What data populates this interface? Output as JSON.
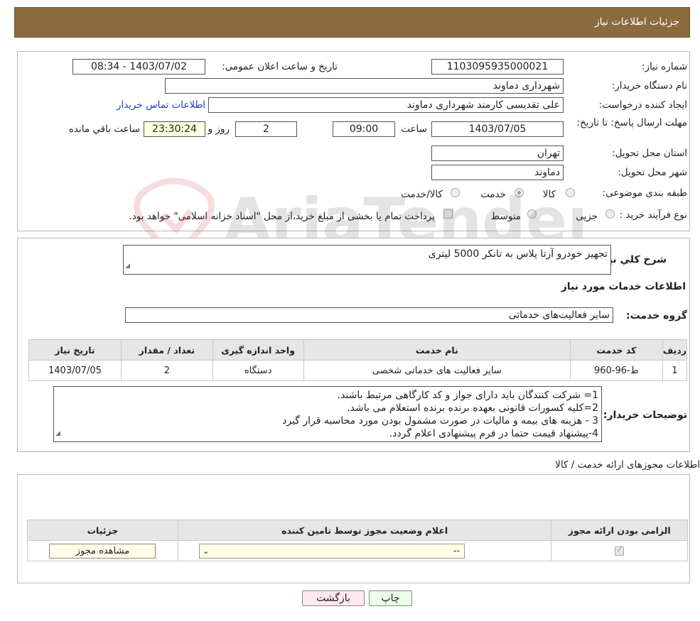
{
  "header": {
    "title": "جزئیات اطلاعات نیاز"
  },
  "form": {
    "need_number_label": "شماره نیاز:",
    "need_number": "1103095935000021",
    "announce_label": "تاریخ و ساعت اعلان عمومی:",
    "announce_value": "1403/07/02 - 08:34",
    "buyer_label": "نام دستگاه خریدار:",
    "buyer_value": "شهرداری دماوند",
    "creator_label": "ایجاد کننده درخواست:",
    "creator_value": "علی تقدیسی کارمند شهرداری دماوند",
    "contact_link": "اطلاعات تماس خریدار",
    "deadline_label": "مهلت ارسال پاسخ: تا تاریخ:",
    "deadline_date": "1403/07/05",
    "time_label": "ساعت",
    "deadline_time": "09:00",
    "days_value": "2",
    "days_label": "روز و",
    "remaining_value": "23:30:24",
    "remaining_label": "ساعت باقي مانده",
    "province_label": "استان محل تحویل:",
    "province_value": "تهران",
    "city_label": "شهر محل تحویل:",
    "city_value": "دماوند",
    "category_label": "طبقه بندی موضوعی:",
    "category_options": [
      "کالا",
      "خدمت",
      "کالا/خدمت"
    ],
    "category_selected": "خدمت",
    "process_label": "نوع فرآیند خرید :",
    "process_options": [
      "جزیی",
      "متوسط"
    ],
    "payment_note": "پرداخت تمام یا بخشی از مبلغ خرید،از محل \"اسناد خزانه اسلامی\" خواهد بود."
  },
  "watermark": {
    "text": "AriaTender.neT"
  },
  "summary": {
    "desc_label": "شرح كلي نياز:",
    "desc_value": "تجهیز خودرو آرتا پلاس به تانکر 5000 لیتری",
    "services_title": "اطلاعات خدمات مورد نیاز",
    "group_label": "گروه خدمت:",
    "group_value": "سایر فعالیت‌های خدماتی"
  },
  "services_table": {
    "headers": [
      "ردیف",
      "کد خدمت",
      "نام خدمت",
      "واحد اندازه گیری",
      "تعداد / مقدار",
      "تاریخ نیاز"
    ],
    "rows": [
      [
        "1",
        "ط-96-960",
        "سایر فعالیت های خدماتی شخصی",
        "دستگاه",
        "2",
        "1403/07/05"
      ]
    ]
  },
  "buyer_notes": {
    "label": "توضیحات خریدار:",
    "lines": [
      "1= شرکت کنندگان باید دارای جواز و کد کارگاهی مرتبط باشند.",
      "2=کلیه کسورات قانونی بعهده برنده برنده استعلام می باشد.",
      "3 - هزینه های بیمه و مالیات در صورت مشمول بودن مورد محاسبه قرار گیرد",
      "4-پیشنهاد قیمت حتما در فرم پیشنهادی اعلام گردد."
    ]
  },
  "permits": {
    "title": "اطلاعات مجوزهای ارائه خدمت / کالا",
    "headers": [
      "الزامی بودن ارائه مجوز",
      "اعلام وضعیت مجوز توسط تامین کننده",
      "جزئیات"
    ],
    "select_value": "--",
    "view_button": "مشاهده مجوز"
  },
  "buttons": {
    "print": "چاپ",
    "back": "بازگشت"
  }
}
